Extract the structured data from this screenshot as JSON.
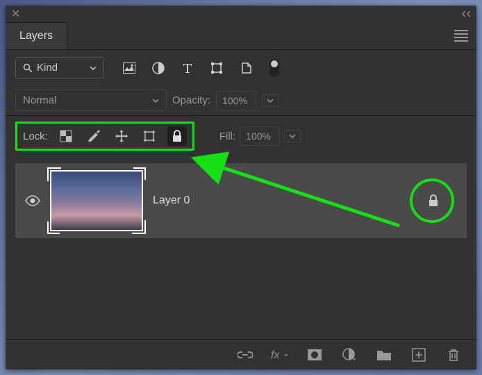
{
  "panel": {
    "tab_label": "Layers"
  },
  "filter": {
    "kind_label": "Kind"
  },
  "blend": {
    "mode": "Normal",
    "opacity_label": "Opacity:",
    "opacity_value": "100%"
  },
  "lock": {
    "label": "Lock:",
    "fill_label": "Fill:",
    "fill_value": "100%"
  },
  "layers": [
    {
      "name": "Layer 0",
      "visible": true,
      "locked": true
    }
  ],
  "annotation": {
    "highlight_color": "#14e014"
  }
}
